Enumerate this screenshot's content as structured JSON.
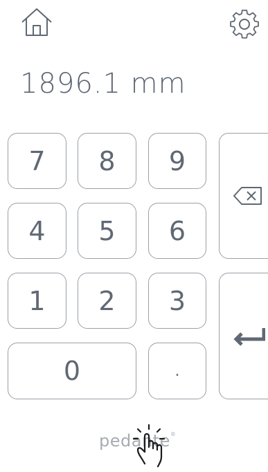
{
  "display": {
    "value": "1896.1 mm"
  },
  "keys": {
    "k7": "7",
    "k8": "8",
    "k9": "9",
    "k4": "4",
    "k5": "5",
    "k6": "6",
    "k1": "1",
    "k2": "2",
    "k3": "3",
    "k0": "0",
    "decimal": "."
  },
  "icons": {
    "home": "home-icon",
    "settings": "gear-icon",
    "backspace": "backspace-icon",
    "enter": "enter-icon",
    "hand": "tap-hand-icon"
  },
  "brand": {
    "text": "pedante",
    "mark": "®"
  },
  "colors": {
    "key_border": "#9aa0a6",
    "text": "#5f6873",
    "brand": "#a7acb2"
  }
}
